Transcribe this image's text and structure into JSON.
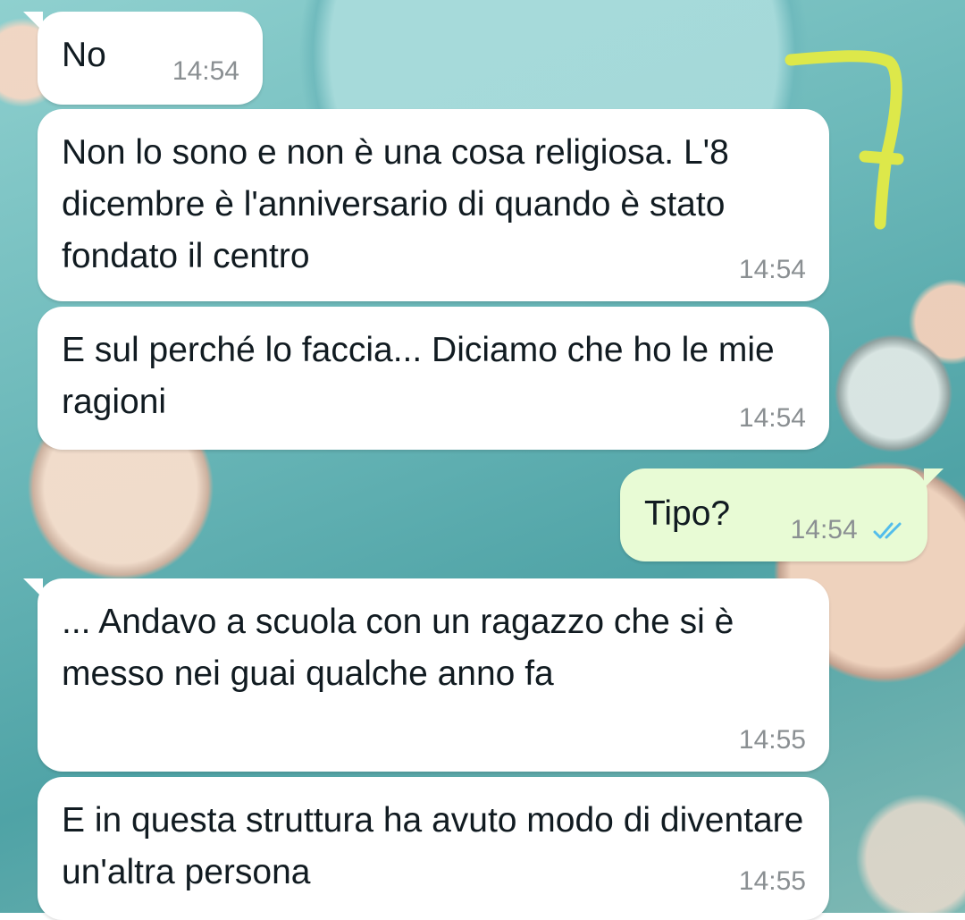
{
  "chat": {
    "messages": [
      {
        "id": "m1",
        "direction": "incoming",
        "text": "No",
        "time": "14:54"
      },
      {
        "id": "m2",
        "direction": "incoming",
        "text": "Non lo sono e non è una cosa religiosa. L'8 dicembre è l'anniversario di quando è stato fondato il centro",
        "time": "14:54"
      },
      {
        "id": "m3",
        "direction": "incoming",
        "text": "E sul perché lo faccia... Diciamo che ho le mie ragioni",
        "time": "14:54"
      },
      {
        "id": "m4",
        "direction": "outgoing",
        "text": "Tipo?",
        "time": "14:54",
        "status_icon": "double-check-read-icon",
        "status_color": "#53bdeb"
      },
      {
        "id": "m5",
        "direction": "incoming",
        "text": "... Andavo a scuola con un ragazzo che si è messo nei guai qualche anno fa",
        "time": "14:55"
      },
      {
        "id": "m6",
        "direction": "incoming",
        "text": "E in questa struttura ha avuto modo di diventare un'altra persona",
        "time": "14:55"
      }
    ]
  },
  "annotation": {
    "icon": "yellow-marker-number-icon",
    "color": "#dde84a"
  },
  "colors": {
    "incoming_bubble": "#ffffff",
    "outgoing_bubble": "#e8fbd5",
    "text": "#111b21",
    "timestamp": "#8a8f92"
  }
}
